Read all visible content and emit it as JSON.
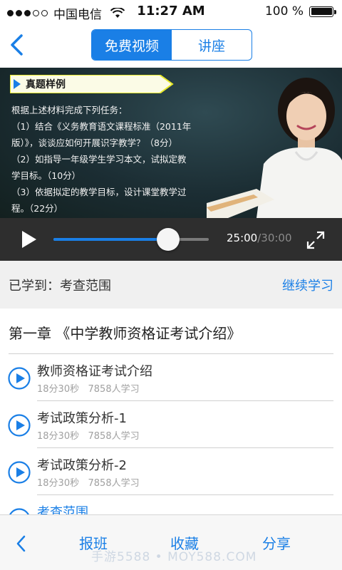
{
  "status_bar": {
    "carrier": "中国电信",
    "time": "11:27 AM",
    "battery": "100 %"
  },
  "nav": {
    "tabs": [
      {
        "label": "免费视频",
        "active": true
      },
      {
        "label": "讲座",
        "active": false
      }
    ]
  },
  "video": {
    "tag_label": "真题样例",
    "board_lines": [
      "根据上述材料完成下列任务：",
      "（1）结合《义务教育语文课程标准（2011年",
      "版）》，谈谈应如何开展识字教学？（8分）",
      "（2）如指导一年级学生学习本文，试拟定教",
      "学目标。（10分）",
      "（3）依据拟定的教学目标，设计课堂教学过",
      "程。（22分）"
    ],
    "progress": 0.74,
    "current_time": "25:00",
    "total_time": "/30:00"
  },
  "learned": {
    "label": "已学到：考查范围",
    "continue_label": "继续学习"
  },
  "chapter": {
    "title": "第一章 《中学教师资格证考试介绍》",
    "lessons": [
      {
        "title": "教师资格证考试介绍",
        "duration": "18分30秒",
        "learners": "7858人学习"
      },
      {
        "title": "考试政策分析-1",
        "duration": "18分30秒",
        "learners": "7858人学习"
      },
      {
        "title": "考试政策分析-2",
        "duration": "18分30秒",
        "learners": "7858人学习"
      },
      {
        "title": "考查范围"
      }
    ]
  },
  "toolbar": {
    "enroll_label": "报班",
    "favorite_label": "收藏",
    "share_label": "分享",
    "watermark": "手游5588 • MOY588.COM"
  },
  "colors": {
    "accent": "#1a7fe6",
    "controls_bg": "#2e2e2e",
    "learned_bg": "#f0f0f0"
  },
  "icons": [
    "signal-icon",
    "wifi-icon",
    "battery-icon",
    "back-chevron-icon",
    "play-icon",
    "fullscreen-icon",
    "play-circle-icon"
  ]
}
